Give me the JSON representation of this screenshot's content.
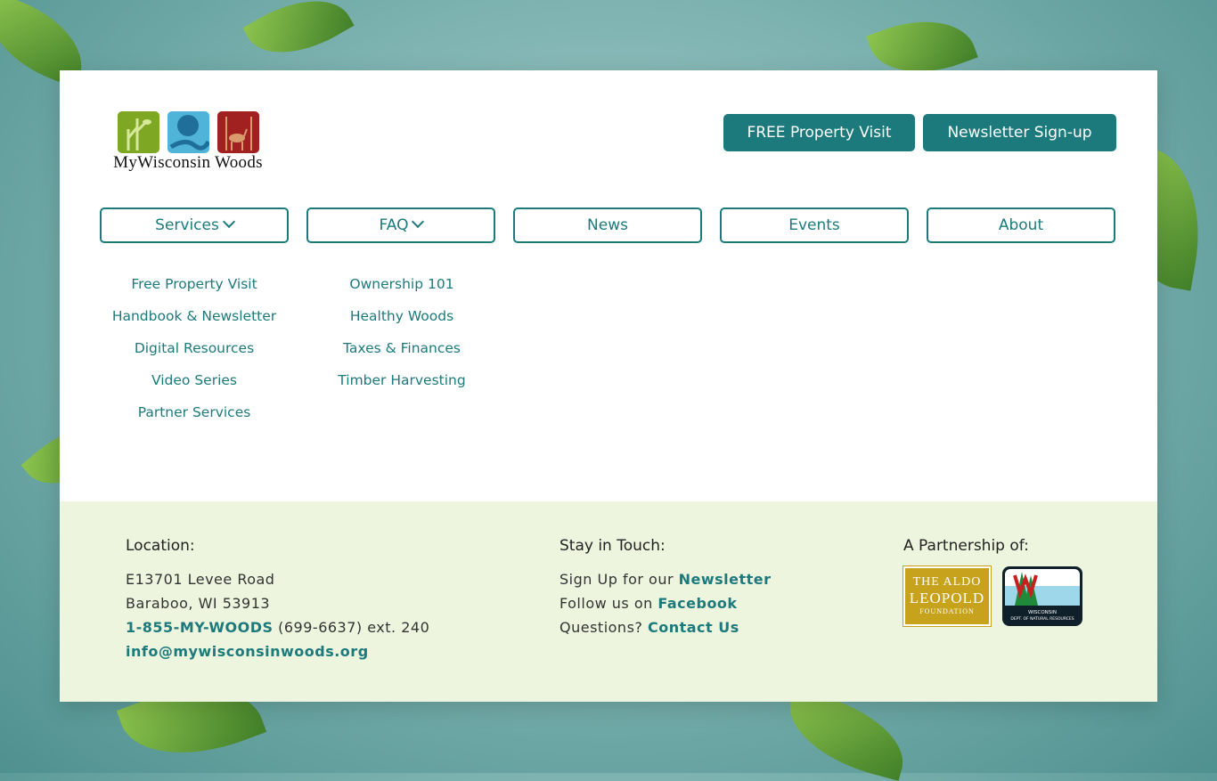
{
  "brand": {
    "name": "MyWisconsin Woods",
    "colors": {
      "teal": "#1d7a7c",
      "green": "#7ea824",
      "blue": "#4fb4d8",
      "red": "#a12020",
      "footer_bg": "#eef5df"
    }
  },
  "header": {
    "buttons": [
      {
        "label": "FREE Property Visit"
      },
      {
        "label": "Newsletter Sign-up"
      }
    ]
  },
  "nav": {
    "items": [
      {
        "label": "Services",
        "has_dropdown": true
      },
      {
        "label": "FAQ",
        "has_dropdown": true
      },
      {
        "label": "News"
      },
      {
        "label": "Events"
      },
      {
        "label": "About"
      }
    ],
    "services_menu": [
      "Free Property Visit",
      "Handbook & Newsletter",
      "Digital Resources",
      "Video Series",
      "Partner Services"
    ],
    "faq_menu": [
      "Ownership 101",
      "Healthy Woods",
      "Taxes & Finances",
      "Timber Harvesting"
    ]
  },
  "footer": {
    "location": {
      "heading": "Location:",
      "address1": "E13701 Levee Road",
      "address2": "Baraboo, WI 53913",
      "phone_link": "1-855-MY-WOODS",
      "phone_rest": " (699-6637) ext. 240",
      "email": "info@mywisconsinwoods.org"
    },
    "touch": {
      "heading": "Stay in Touch:",
      "line1_text": "Sign Up for our ",
      "line1_link": "Newsletter",
      "line2_text": "Follow us on ",
      "line2_link": "Facebook",
      "line3_text": "Questions? ",
      "line3_link": "Contact Us"
    },
    "partnership": {
      "heading": "A Partnership of:",
      "aldo_lines": [
        "THE ALDO",
        "LEOPOLD",
        "FOUNDATION"
      ],
      "dnr_lines": [
        "WISCONSIN",
        "DEPT. OF NATURAL RESOURCES"
      ]
    }
  },
  "icons": [
    "chevron-down-icon",
    "bird-tile-icon",
    "river-tile-icon",
    "deer-tile-icon"
  ]
}
